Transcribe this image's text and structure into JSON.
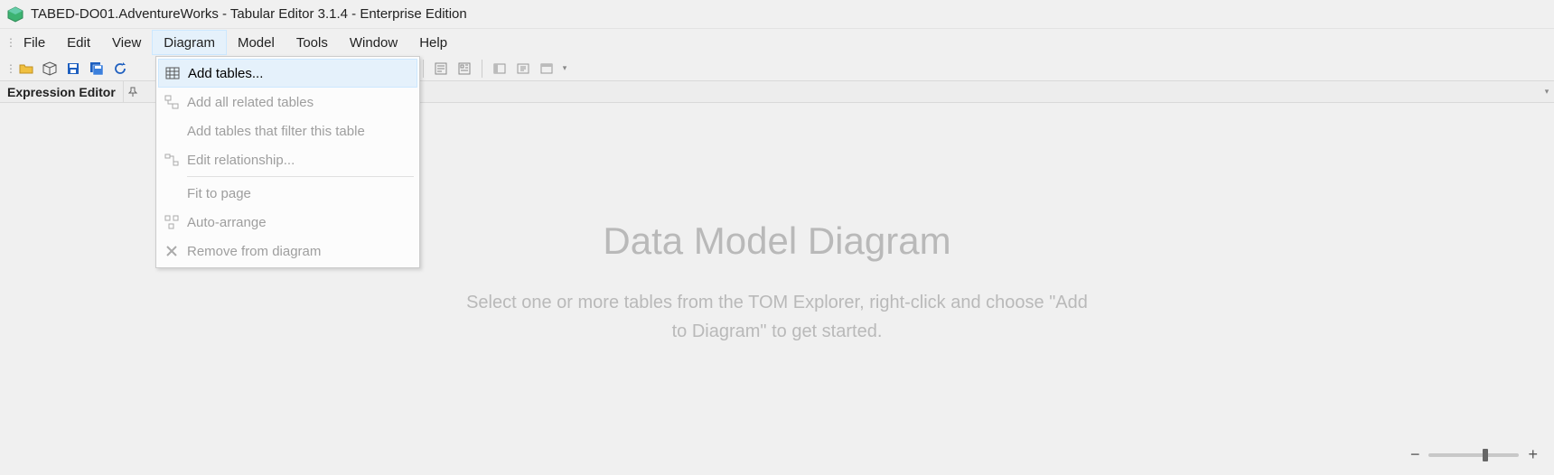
{
  "titlebar": {
    "text": "TABED-DO01.AdventureWorks - Tabular Editor 3.1.4 - Enterprise Edition"
  },
  "menubar": {
    "items": [
      {
        "label": "File"
      },
      {
        "label": "Edit"
      },
      {
        "label": "View"
      },
      {
        "label": "Diagram",
        "open": true
      },
      {
        "label": "Model"
      },
      {
        "label": "Tools"
      },
      {
        "label": "Window"
      },
      {
        "label": "Help"
      }
    ]
  },
  "dropdown": {
    "groups": [
      [
        {
          "label": "Add tables...",
          "icon": "table-icon",
          "highlight": true,
          "enabled": true
        },
        {
          "label": "Add all related tables",
          "icon": "related-tables-icon",
          "enabled": false
        },
        {
          "label": "Add tables that filter this table",
          "icon": "none",
          "enabled": false
        },
        {
          "label": "Edit relationship...",
          "icon": "edit-relationship-icon",
          "enabled": false
        }
      ],
      [
        {
          "label": "Fit to page",
          "icon": "none",
          "enabled": false
        },
        {
          "label": "Auto-arrange",
          "icon": "auto-arrange-icon",
          "enabled": false
        },
        {
          "label": "Remove from diagram",
          "icon": "remove-icon",
          "enabled": false
        }
      ]
    ]
  },
  "expression_editor": {
    "label": "Expression Editor"
  },
  "placeholder": {
    "title": "Data Model Diagram",
    "subtitle": "Select one or more tables from the TOM Explorer, right-click and choose \"Add to Diagram\" to get started."
  },
  "zoom": {
    "minus": "−",
    "plus": "+",
    "value_pct": 60
  }
}
